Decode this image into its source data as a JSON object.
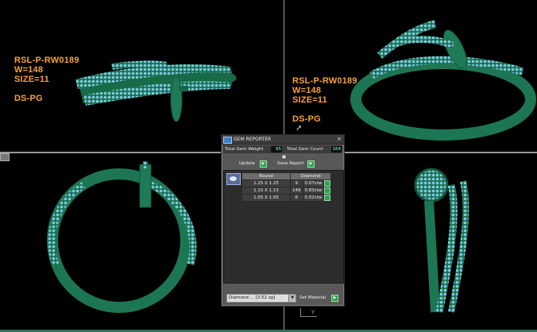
{
  "labels_tl": [
    "RSL-P-RW0189",
    "W=148",
    "SIZE=11",
    "",
    "DS-PG"
  ],
  "labels_tr": [
    "RSL-P-RW0189",
    "W=148",
    "SIZE=11",
    "",
    "DS-PG"
  ],
  "axis_label": "y",
  "colors": {
    "metal": "#1f7a57",
    "gem": "#7ec8e6",
    "label": "#f6a23a"
  },
  "gem_reporter": {
    "title": "GEM REPORTER",
    "close_glyph": "×",
    "total_weight_label": "Total Gem Weight",
    "total_weight_value": "95",
    "total_count_label": "Total Gem Count",
    "total_count_value": "164",
    "update_label": "Update",
    "save_report_label": "Save Report",
    "columns": [
      "Round",
      "Diamond"
    ],
    "rows": [
      {
        "size": "1.25 X 1.25",
        "count": "9",
        "weight": "0.07ctw"
      },
      {
        "size": "1.15 X 1.15",
        "count": "149",
        "weight": "0.83ctw"
      },
      {
        "size": "1.05 X 1.05",
        "count": "6",
        "weight": "0.02ctw"
      }
    ],
    "material_value": "Diamond ... [3.52 sg]",
    "set_material_label": "Set Material"
  }
}
